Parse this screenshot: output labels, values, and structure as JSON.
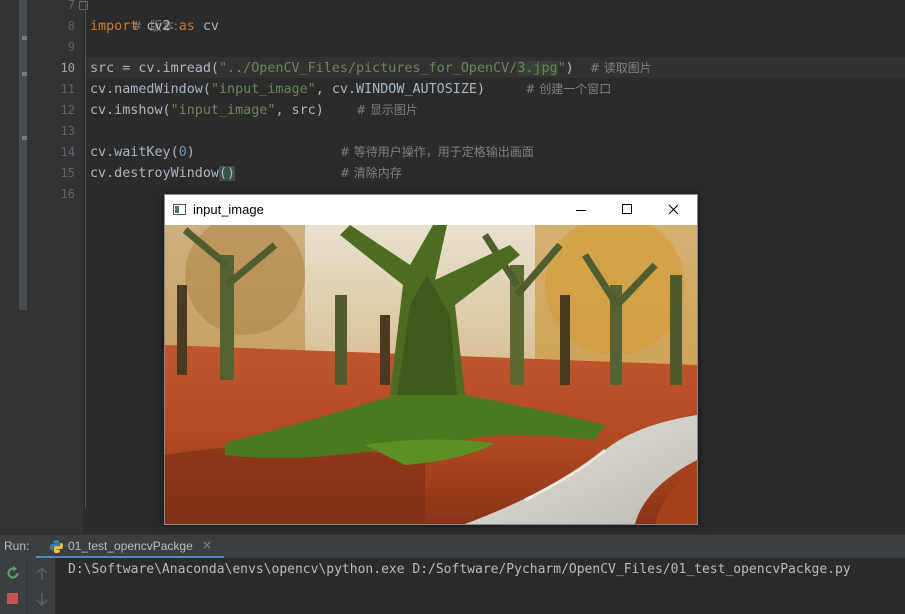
{
  "editor": {
    "line_numbers": [
      "7",
      "8",
      "9",
      "10",
      "11",
      "12",
      "13",
      "14",
      "15",
      "16"
    ],
    "current_line": "10",
    "lines": {
      "l7_comment": "#  版本:",
      "l8_import": "import",
      "l8_module": " cv2 ",
      "l8_as": "as",
      "l8_alias": " cv",
      "l10_code": "src = cv.imread(",
      "l10_str_a": "\"../OpenCV_Files/pictures_for_OpenCV/",
      "l10_str_sel": "3.jpg",
      "l10_str_b": "\"",
      "l10_close": ")  ",
      "l10_comment": "# 读取图片",
      "l11_code": "cv.namedWindow(",
      "l11_str": "\"input_image\"",
      "l11_rest": ", cv.WINDOW_AUTOSIZE)     ",
      "l11_comment": "# 创建一个窗口",
      "l12_code": "cv.imshow(",
      "l12_str": "\"input_image\"",
      "l12_rest": ", src)    ",
      "l12_comment": "# 显示图片",
      "l14_code": "cv.waitKey(",
      "l14_num": "0",
      "l14_rest": ")                  ",
      "l14_comment": "# 等待用户操作，用于定格输出画面",
      "l15_code": "cv.destroyWindow",
      "l15_paren": "()",
      "l15_rest": "             ",
      "l15_comment": "# 清除内存"
    }
  },
  "image_window": {
    "title": "input_image",
    "minimize_icon": "minimize-icon",
    "maximize_icon": "maximize-icon",
    "close_icon": "close-icon"
  },
  "run_panel": {
    "label": "Run:",
    "tab_label": "01_test_opencvPackge",
    "tab_close": "×",
    "console_output": "D:\\Software\\Anaconda\\envs\\opencv\\python.exe D:/Software/Pycharm/OpenCV_Files/01_test_opencvPackge.py"
  },
  "colors": {
    "editor_bg": "#2b2b2b",
    "keyword": "#cc7832",
    "string": "#6a8759",
    "number": "#6897bb",
    "comment": "#808080",
    "accent": "#4a88c7"
  }
}
